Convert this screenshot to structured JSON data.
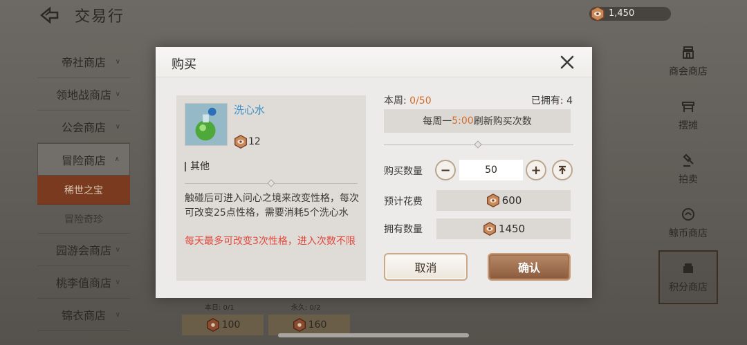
{
  "topbar": {
    "title": "交易行",
    "currency": "1,450"
  },
  "left_nav": {
    "items": [
      {
        "label": "帝社商店"
      },
      {
        "label": "领地战商店"
      },
      {
        "label": "公会商店"
      },
      {
        "label": "冒险商店"
      },
      {
        "label": "稀世之宝"
      },
      {
        "label": "冒险奇珍"
      },
      {
        "label": "园游会商店"
      },
      {
        "label": "桃李值商店"
      },
      {
        "label": "锦衣商店"
      }
    ]
  },
  "right_nav": {
    "items": [
      {
        "label": "商会商店",
        "icon": "shop-icon"
      },
      {
        "label": "摆摊",
        "icon": "stall-icon"
      },
      {
        "label": "拍卖",
        "icon": "gavel-icon"
      },
      {
        "label": "鲸币商店",
        "icon": "whale-coin-icon"
      },
      {
        "label": "积分商店",
        "icon": "points-icon"
      }
    ]
  },
  "bg_cards": [
    {
      "limit": "本日: 0/1",
      "price": "100"
    },
    {
      "limit": "永久: 0/2",
      "price": "160"
    }
  ],
  "modal": {
    "title": "购买",
    "item": {
      "name": "洗心水",
      "cost": "12",
      "category": "其他",
      "description": "触碰后可进入问心之境来改变性格，每次可改变25点性格，需要消耗5个洗心水",
      "warning": "每天最多可改变3次性格，进入次数不限"
    },
    "weekly_label": "本周: ",
    "weekly_value": "0/50",
    "owned": "已拥有: 4",
    "refresh_prefix": "每周一",
    "refresh_time": "5:00",
    "refresh_suffix": "刷新购买次数",
    "quantity_label": "购买数量",
    "quantity_value": "50",
    "cost_label": "预计花费",
    "cost_value": "600",
    "have_label": "拥有数量",
    "have_value": "1450",
    "cancel_label": "取消",
    "confirm_label": "确认"
  },
  "colors": {
    "accent_orange": "#d26b2c",
    "link_blue": "#3d8fc9",
    "warning_red": "#e2473b",
    "confirm_brown": "#8a5a3c"
  }
}
